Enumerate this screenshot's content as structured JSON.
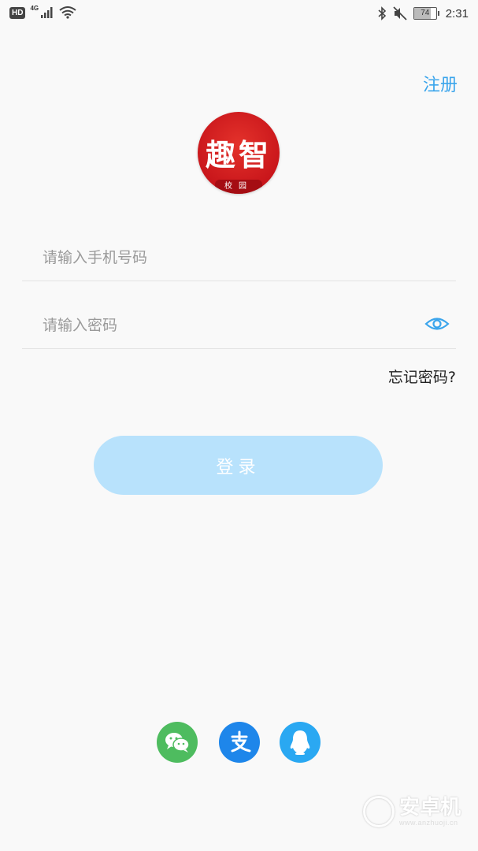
{
  "status_bar": {
    "hd_label": "HD",
    "network_label": "4G",
    "battery_level": "74",
    "battery_fraction": 0.74,
    "time": "2:31"
  },
  "header": {
    "register_label": "注册"
  },
  "logo": {
    "main_text": "趣智",
    "sub_text": "校园",
    "color": "#d21f20"
  },
  "form": {
    "phone_placeholder": "请输入手机号码",
    "phone_value": "",
    "password_placeholder": "请输入密码",
    "password_value": "",
    "forgot_label": "忘记密码?",
    "login_label": "登录"
  },
  "social_login": {
    "items": [
      {
        "name": "wechat-icon",
        "color": "#4ebc5f"
      },
      {
        "name": "alipay-icon",
        "color": "#1e86ea"
      },
      {
        "name": "qq-icon",
        "color": "#2aa8f2"
      }
    ]
  },
  "watermark": {
    "main": "安卓机",
    "sub": "www.anzhuoji.cn"
  },
  "colors": {
    "accent": "#3ba5ec",
    "login_button": "#b8e2fc",
    "background": "#f9f9f9"
  }
}
